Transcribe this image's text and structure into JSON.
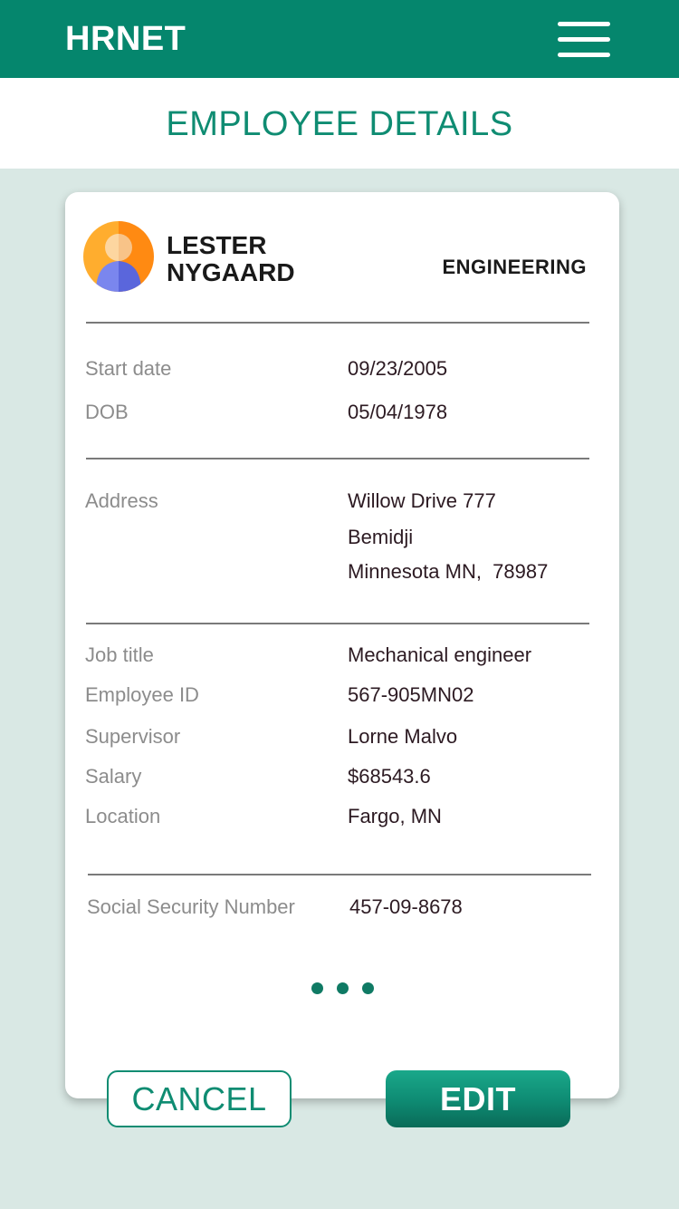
{
  "app": {
    "brand": "HRNET"
  },
  "header": {
    "title": "EMPLOYEE DETAILS",
    "menu_icon": "hamburger-menu-icon"
  },
  "employee": {
    "name": "LESTER\nNYGAARD",
    "department": "ENGINEERING",
    "avatar_icon": "user-avatar-icon"
  },
  "dates": {
    "start_label": "Start date",
    "start_value": "09/23/2005",
    "dob_label": "DOB",
    "dob_value": "05/04/1978"
  },
  "address": {
    "label": "Address",
    "line1": "Willow Drive 777",
    "line2": "Bemidji",
    "line3": "Minnesota MN,  78987"
  },
  "job": {
    "title_label": "Job title",
    "title_value": "Mechanical engineer",
    "id_label": "Employee ID",
    "id_value": "567-905MN02",
    "supervisor_label": "Supervisor",
    "supervisor_value": "Lorne Malvo",
    "salary_label": "Salary",
    "salary_value": "$68543.6",
    "location_label": "Location",
    "location_value": "Fargo, MN"
  },
  "ssn": {
    "label": "Social Security Number",
    "value": "457-09-8678"
  },
  "actions": {
    "cancel_label": "CANCEL",
    "edit_label": "EDIT"
  },
  "colors": {
    "primary": "#05866d",
    "title": "#0f8c72",
    "background": "#d9e8e4"
  }
}
